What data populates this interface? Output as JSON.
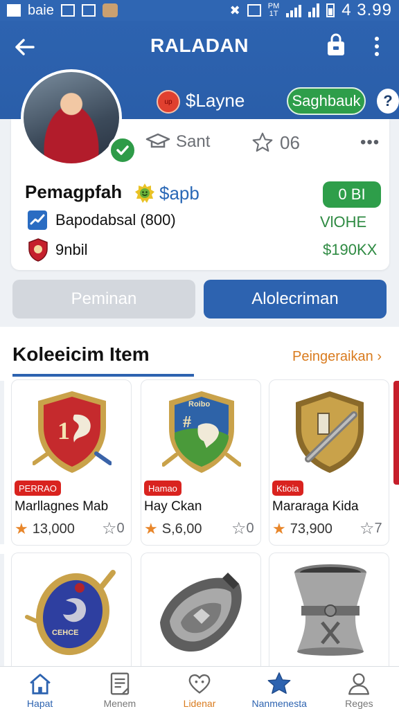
{
  "status_bar": {
    "carrier": "baie",
    "time": "4 3.99",
    "network_small": "PM\n1T"
  },
  "header": {
    "title": "RALADAN"
  },
  "profile": {
    "coin_label": "$Layne",
    "coin_tag": "up",
    "pill_label": "Saghbauk",
    "help_label": "?",
    "stat_1": "Sant",
    "stat_2": "06",
    "more_label": "•••",
    "name": "Pemagpfah",
    "handle": "$apb",
    "balance": "0 BI",
    "row2_text": "Bapodabsal (800)",
    "row2_value": "VlOHE",
    "row3_text": "9nbil",
    "row3_value": "$190KX"
  },
  "actions": {
    "secondary": "Peminan",
    "primary": "Alolecriman"
  },
  "collection": {
    "title": "Koleeicim Item",
    "see_all": "Peingeraikan",
    "items": [
      {
        "tag": "PERRAO",
        "name": "Marllagnes Mab",
        "price": "13,000",
        "fav": "0"
      },
      {
        "tag": "Hamao",
        "name": "Hay Ckan",
        "price": "S,6,00",
        "fav": "0"
      },
      {
        "tag": "Ktioia",
        "name": "Mararaga Kida",
        "price": "73,900",
        "fav": "7"
      }
    ],
    "row2_items": [
      {
        "art_label": "CEHCE"
      },
      {
        "art_label": ""
      },
      {
        "art_label": ""
      }
    ]
  },
  "bottom_nav": [
    {
      "label": "Hapat",
      "icon": "home-icon"
    },
    {
      "label": "Menem",
      "icon": "document-icon"
    },
    {
      "label": "Lidenar",
      "icon": "heart-icon"
    },
    {
      "label": "Nanmenesta",
      "icon": "star-icon"
    },
    {
      "label": "Reges",
      "icon": "person-icon"
    }
  ],
  "colors": {
    "primary": "#2d63b0",
    "green": "#2e9e4a",
    "orange": "#d97b1e",
    "red": "#d9231f"
  }
}
